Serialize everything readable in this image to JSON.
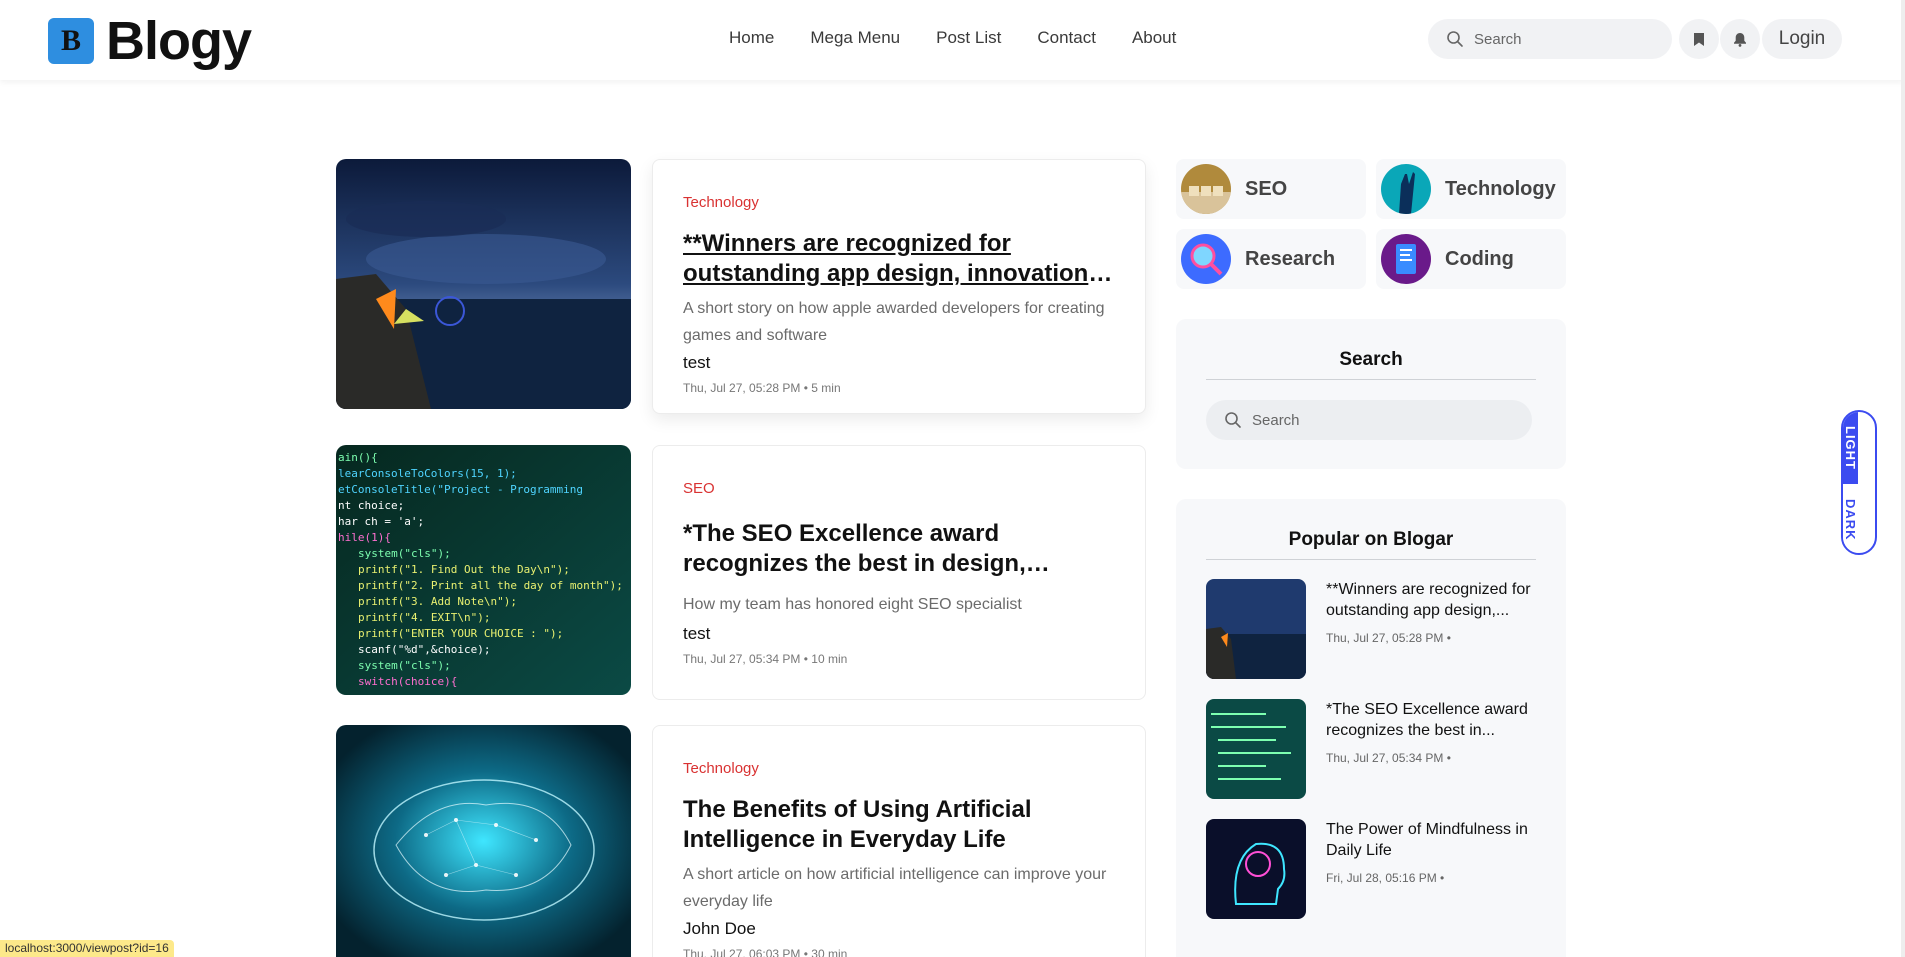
{
  "header": {
    "logo_letter": "B",
    "brand": "Blogy",
    "nav": [
      "Home",
      "Mega Menu",
      "Post List",
      "Contact",
      "About"
    ],
    "search_placeholder": "Search",
    "login_label": "Login",
    "icons": [
      "bookmark-icon",
      "bell-icon",
      "search-icon"
    ]
  },
  "posts": [
    {
      "category": "Technology",
      "title": "**Winners are recognized for outstanding app design, innovation, and technical achievement",
      "description": "A short story on how apple awarded developers for creating games and software",
      "author": "test",
      "meta": "Thu, Jul 27, 05:28 PM • 5 min"
    },
    {
      "category": "SEO",
      "title": "*The SEO Excellence award recognizes the best in design, content and strategy",
      "description": "How my team has honored eight SEO specialist",
      "author": "test",
      "meta": "Thu, Jul 27, 05:34 PM • 10 min"
    },
    {
      "category": "Technology",
      "title": "The Benefits of Using Artificial Intelligence in Everyday Life",
      "description": "A short article on how artificial intelligence can improve your everyday life",
      "author": "John Doe",
      "meta": "Thu, Jul 27, 06:03 PM • 30 min"
    }
  ],
  "categories": [
    "SEO",
    "Technology",
    "Research",
    "Coding"
  ],
  "sidebar_search": {
    "title": "Search",
    "placeholder": "Search"
  },
  "popular": {
    "title": "Popular on Blogar",
    "items": [
      {
        "title": "**Winners are recognized for outstanding app design,...",
        "date": "Thu, Jul 27, 05:28 PM •"
      },
      {
        "title": "*The SEO Excellence award recognizes the best in...",
        "date": "Thu, Jul 27, 05:34 PM •"
      },
      {
        "title": "The Power of Mindfulness in Daily Life",
        "date": "Fri, Jul 28, 05:16 PM •"
      }
    ]
  },
  "theme_toggle": {
    "light": "LIGHT",
    "dark": "DARK"
  },
  "status_url": "localhost:3000/viewpost?id=16",
  "colors": {
    "accent": "#3b4bf0",
    "category": "#d93232",
    "logo": "#2e8ee0"
  }
}
